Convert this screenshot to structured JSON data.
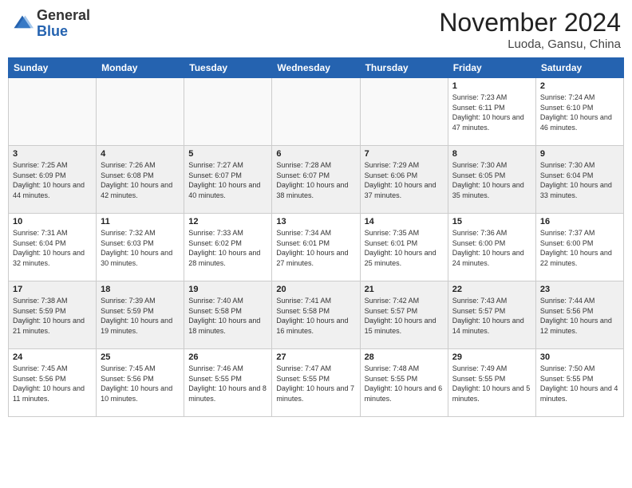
{
  "header": {
    "logo_general": "General",
    "logo_blue": "Blue",
    "month_title": "November 2024",
    "location": "Luoda, Gansu, China"
  },
  "days_of_week": [
    "Sunday",
    "Monday",
    "Tuesday",
    "Wednesday",
    "Thursday",
    "Friday",
    "Saturday"
  ],
  "weeks": [
    [
      {
        "day": "",
        "info": ""
      },
      {
        "day": "",
        "info": ""
      },
      {
        "day": "",
        "info": ""
      },
      {
        "day": "",
        "info": ""
      },
      {
        "day": "",
        "info": ""
      },
      {
        "day": "1",
        "info": "Sunrise: 7:23 AM\nSunset: 6:11 PM\nDaylight: 10 hours and 47 minutes."
      },
      {
        "day": "2",
        "info": "Sunrise: 7:24 AM\nSunset: 6:10 PM\nDaylight: 10 hours and 46 minutes."
      }
    ],
    [
      {
        "day": "3",
        "info": "Sunrise: 7:25 AM\nSunset: 6:09 PM\nDaylight: 10 hours and 44 minutes."
      },
      {
        "day": "4",
        "info": "Sunrise: 7:26 AM\nSunset: 6:08 PM\nDaylight: 10 hours and 42 minutes."
      },
      {
        "day": "5",
        "info": "Sunrise: 7:27 AM\nSunset: 6:07 PM\nDaylight: 10 hours and 40 minutes."
      },
      {
        "day": "6",
        "info": "Sunrise: 7:28 AM\nSunset: 6:07 PM\nDaylight: 10 hours and 38 minutes."
      },
      {
        "day": "7",
        "info": "Sunrise: 7:29 AM\nSunset: 6:06 PM\nDaylight: 10 hours and 37 minutes."
      },
      {
        "day": "8",
        "info": "Sunrise: 7:30 AM\nSunset: 6:05 PM\nDaylight: 10 hours and 35 minutes."
      },
      {
        "day": "9",
        "info": "Sunrise: 7:30 AM\nSunset: 6:04 PM\nDaylight: 10 hours and 33 minutes."
      }
    ],
    [
      {
        "day": "10",
        "info": "Sunrise: 7:31 AM\nSunset: 6:04 PM\nDaylight: 10 hours and 32 minutes."
      },
      {
        "day": "11",
        "info": "Sunrise: 7:32 AM\nSunset: 6:03 PM\nDaylight: 10 hours and 30 minutes."
      },
      {
        "day": "12",
        "info": "Sunrise: 7:33 AM\nSunset: 6:02 PM\nDaylight: 10 hours and 28 minutes."
      },
      {
        "day": "13",
        "info": "Sunrise: 7:34 AM\nSunset: 6:01 PM\nDaylight: 10 hours and 27 minutes."
      },
      {
        "day": "14",
        "info": "Sunrise: 7:35 AM\nSunset: 6:01 PM\nDaylight: 10 hours and 25 minutes."
      },
      {
        "day": "15",
        "info": "Sunrise: 7:36 AM\nSunset: 6:00 PM\nDaylight: 10 hours and 24 minutes."
      },
      {
        "day": "16",
        "info": "Sunrise: 7:37 AM\nSunset: 6:00 PM\nDaylight: 10 hours and 22 minutes."
      }
    ],
    [
      {
        "day": "17",
        "info": "Sunrise: 7:38 AM\nSunset: 5:59 PM\nDaylight: 10 hours and 21 minutes."
      },
      {
        "day": "18",
        "info": "Sunrise: 7:39 AM\nSunset: 5:59 PM\nDaylight: 10 hours and 19 minutes."
      },
      {
        "day": "19",
        "info": "Sunrise: 7:40 AM\nSunset: 5:58 PM\nDaylight: 10 hours and 18 minutes."
      },
      {
        "day": "20",
        "info": "Sunrise: 7:41 AM\nSunset: 5:58 PM\nDaylight: 10 hours and 16 minutes."
      },
      {
        "day": "21",
        "info": "Sunrise: 7:42 AM\nSunset: 5:57 PM\nDaylight: 10 hours and 15 minutes."
      },
      {
        "day": "22",
        "info": "Sunrise: 7:43 AM\nSunset: 5:57 PM\nDaylight: 10 hours and 14 minutes."
      },
      {
        "day": "23",
        "info": "Sunrise: 7:44 AM\nSunset: 5:56 PM\nDaylight: 10 hours and 12 minutes."
      }
    ],
    [
      {
        "day": "24",
        "info": "Sunrise: 7:45 AM\nSunset: 5:56 PM\nDaylight: 10 hours and 11 minutes."
      },
      {
        "day": "25",
        "info": "Sunrise: 7:45 AM\nSunset: 5:56 PM\nDaylight: 10 hours and 10 minutes."
      },
      {
        "day": "26",
        "info": "Sunrise: 7:46 AM\nSunset: 5:55 PM\nDaylight: 10 hours and 8 minutes."
      },
      {
        "day": "27",
        "info": "Sunrise: 7:47 AM\nSunset: 5:55 PM\nDaylight: 10 hours and 7 minutes."
      },
      {
        "day": "28",
        "info": "Sunrise: 7:48 AM\nSunset: 5:55 PM\nDaylight: 10 hours and 6 minutes."
      },
      {
        "day": "29",
        "info": "Sunrise: 7:49 AM\nSunset: 5:55 PM\nDaylight: 10 hours and 5 minutes."
      },
      {
        "day": "30",
        "info": "Sunrise: 7:50 AM\nSunset: 5:55 PM\nDaylight: 10 hours and 4 minutes."
      }
    ]
  ]
}
